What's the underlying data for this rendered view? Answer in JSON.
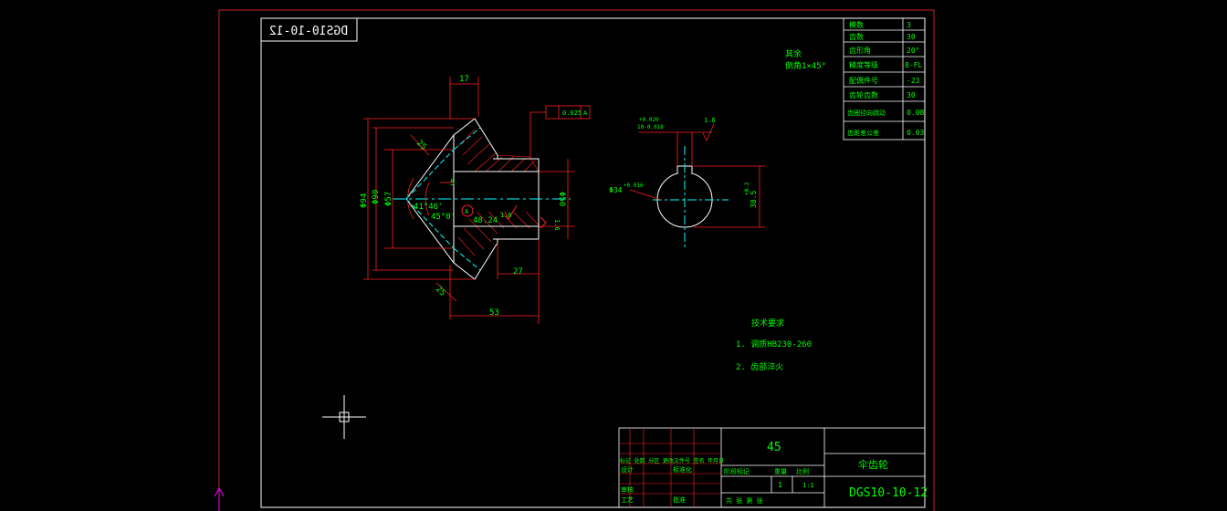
{
  "colors": {
    "background": "#000000",
    "frame_outer": "#cc2222",
    "frame_inner": "#ffffff",
    "geometry": "#ffffff",
    "dimension": "#ff2020",
    "text": "#00ff00",
    "centerline": "#00ffff",
    "hatch": "#ff2020",
    "ucs": "#ff00ff"
  },
  "drawing": {
    "mirrored_id": "DGS10-10-12",
    "note_remaining": "其余",
    "note_chamfer": "倒角1×45°",
    "dims_section": {
      "top_width": "17",
      "d94": "Φ94",
      "d90": "Φ90",
      "d57": "Φ57",
      "d50": "Φ50",
      "cone_small": "5",
      "angle1": "41°46'",
      "angle2": "45°0'",
      "dim_48": "48.24",
      "face_len": "25",
      "side_len": "25",
      "hub_len": "27",
      "total_len": "53",
      "roughness_bore": "1.6",
      "roughness_face": "1.6",
      "datum": "A",
      "tol_val": "0.025",
      "tol_ref": "A"
    },
    "dims_view": {
      "key_tol_top": "+0.020",
      "key_tol_bot": "10-0.018",
      "key_roughness": "1.6",
      "bore_dim": "Φ34",
      "bore_tol": "+0.016",
      "keyway_depth": "38.5",
      "keyway_tol": "+0.2"
    },
    "tech_req_title": "技术要求",
    "tech_req_1": "1. 调质HB230-260",
    "tech_req_2": "2. 齿部淬火"
  },
  "gear_table": [
    {
      "label": "模数",
      "value": "3"
    },
    {
      "label": "齿数",
      "value": "30"
    },
    {
      "label": "齿形角",
      "value": "20°"
    },
    {
      "label": "精度等级",
      "value": "8-FL"
    },
    {
      "label": "配偶件号",
      "value": "-23"
    },
    {
      "label": "齿轮齿数",
      "value": "30"
    },
    {
      "label": "齿圈径向跳动",
      "value": "0.08"
    },
    {
      "label": "齿距差公差",
      "value": "0.03"
    }
  ],
  "title_block": {
    "material": "45",
    "part_name": "伞齿轮",
    "drawing_no": "DGS10-10-12",
    "qty": "1",
    "scale": "1:1",
    "header_marks": "标记 处数 分区 更改文件号 签名 年月日",
    "row_design": "设计",
    "row_std": "标准化",
    "row_review": "审核",
    "row_process": "工艺",
    "row_approve": "批准",
    "stage_marks": "阶段标记",
    "weight": "重量",
    "ratio": "比例",
    "sheets": "共 张 第 张"
  }
}
